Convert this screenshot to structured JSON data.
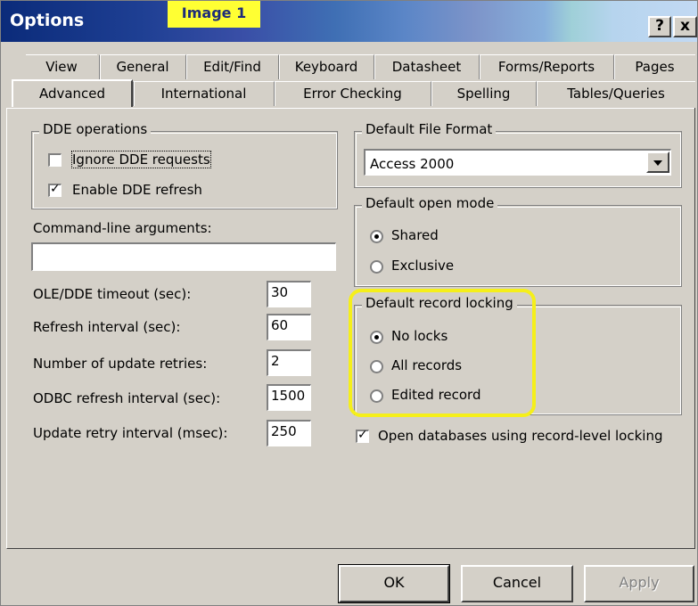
{
  "window": {
    "title": "Options",
    "badge": "Image 1",
    "help_label": "?",
    "close_label": "x"
  },
  "tabs_row1": [
    "View",
    "General",
    "Edit/Find",
    "Keyboard",
    "Datasheet",
    "Forms/Reports",
    "Pages"
  ],
  "tabs_row2": [
    "Advanced",
    "International",
    "Error Checking",
    "Spelling",
    "Tables/Queries"
  ],
  "active_tab": "Advanced",
  "dde": {
    "legend": "DDE operations",
    "ignore": {
      "label": "Ignore DDE requests",
      "checked": false
    },
    "refresh": {
      "label": "Enable DDE refresh",
      "checked": true
    }
  },
  "command_line": {
    "label": "Command-line arguments:",
    "value": ""
  },
  "settings": [
    {
      "label": "OLE/DDE timeout (sec):",
      "value": "30"
    },
    {
      "label": "Refresh interval (sec):",
      "value": "60"
    },
    {
      "label": "Number of update retries:",
      "value": "2"
    },
    {
      "label": "ODBC refresh interval (sec):",
      "value": "1500"
    },
    {
      "label": "Update retry interval (msec):",
      "value": "250"
    }
  ],
  "file_format": {
    "legend": "Default File Format",
    "value": "Access 2000"
  },
  "open_mode": {
    "legend": "Default open mode",
    "options": [
      "Shared",
      "Exclusive"
    ],
    "selected": "Shared"
  },
  "record_locking": {
    "legend": "Default record locking",
    "options": [
      "No locks",
      "All records",
      "Edited record"
    ],
    "selected": "No locks"
  },
  "record_level": {
    "label": "Open databases using record-level locking",
    "checked": true
  },
  "buttons": {
    "ok": "OK",
    "cancel": "Cancel",
    "apply": "Apply"
  },
  "colors": {
    "highlight": "#f5ef1a",
    "badge": "#ffff33"
  }
}
